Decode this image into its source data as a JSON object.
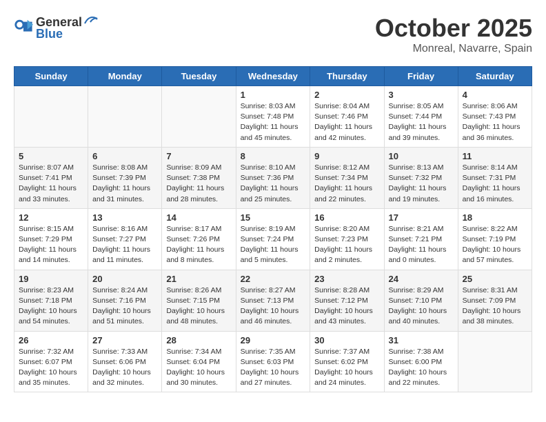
{
  "header": {
    "logo_general": "General",
    "logo_blue": "Blue",
    "month": "October 2025",
    "location": "Monreal, Navarre, Spain"
  },
  "weekdays": [
    "Sunday",
    "Monday",
    "Tuesday",
    "Wednesday",
    "Thursday",
    "Friday",
    "Saturday"
  ],
  "weeks": [
    [
      {
        "day": "",
        "info": ""
      },
      {
        "day": "",
        "info": ""
      },
      {
        "day": "",
        "info": ""
      },
      {
        "day": "1",
        "info": "Sunrise: 8:03 AM\nSunset: 7:48 PM\nDaylight: 11 hours and 45 minutes."
      },
      {
        "day": "2",
        "info": "Sunrise: 8:04 AM\nSunset: 7:46 PM\nDaylight: 11 hours and 42 minutes."
      },
      {
        "day": "3",
        "info": "Sunrise: 8:05 AM\nSunset: 7:44 PM\nDaylight: 11 hours and 39 minutes."
      },
      {
        "day": "4",
        "info": "Sunrise: 8:06 AM\nSunset: 7:43 PM\nDaylight: 11 hours and 36 minutes."
      }
    ],
    [
      {
        "day": "5",
        "info": "Sunrise: 8:07 AM\nSunset: 7:41 PM\nDaylight: 11 hours and 33 minutes."
      },
      {
        "day": "6",
        "info": "Sunrise: 8:08 AM\nSunset: 7:39 PM\nDaylight: 11 hours and 31 minutes."
      },
      {
        "day": "7",
        "info": "Sunrise: 8:09 AM\nSunset: 7:38 PM\nDaylight: 11 hours and 28 minutes."
      },
      {
        "day": "8",
        "info": "Sunrise: 8:10 AM\nSunset: 7:36 PM\nDaylight: 11 hours and 25 minutes."
      },
      {
        "day": "9",
        "info": "Sunrise: 8:12 AM\nSunset: 7:34 PM\nDaylight: 11 hours and 22 minutes."
      },
      {
        "day": "10",
        "info": "Sunrise: 8:13 AM\nSunset: 7:32 PM\nDaylight: 11 hours and 19 minutes."
      },
      {
        "day": "11",
        "info": "Sunrise: 8:14 AM\nSunset: 7:31 PM\nDaylight: 11 hours and 16 minutes."
      }
    ],
    [
      {
        "day": "12",
        "info": "Sunrise: 8:15 AM\nSunset: 7:29 PM\nDaylight: 11 hours and 14 minutes."
      },
      {
        "day": "13",
        "info": "Sunrise: 8:16 AM\nSunset: 7:27 PM\nDaylight: 11 hours and 11 minutes."
      },
      {
        "day": "14",
        "info": "Sunrise: 8:17 AM\nSunset: 7:26 PM\nDaylight: 11 hours and 8 minutes."
      },
      {
        "day": "15",
        "info": "Sunrise: 8:19 AM\nSunset: 7:24 PM\nDaylight: 11 hours and 5 minutes."
      },
      {
        "day": "16",
        "info": "Sunrise: 8:20 AM\nSunset: 7:23 PM\nDaylight: 11 hours and 2 minutes."
      },
      {
        "day": "17",
        "info": "Sunrise: 8:21 AM\nSunset: 7:21 PM\nDaylight: 11 hours and 0 minutes."
      },
      {
        "day": "18",
        "info": "Sunrise: 8:22 AM\nSunset: 7:19 PM\nDaylight: 10 hours and 57 minutes."
      }
    ],
    [
      {
        "day": "19",
        "info": "Sunrise: 8:23 AM\nSunset: 7:18 PM\nDaylight: 10 hours and 54 minutes."
      },
      {
        "day": "20",
        "info": "Sunrise: 8:24 AM\nSunset: 7:16 PM\nDaylight: 10 hours and 51 minutes."
      },
      {
        "day": "21",
        "info": "Sunrise: 8:26 AM\nSunset: 7:15 PM\nDaylight: 10 hours and 48 minutes."
      },
      {
        "day": "22",
        "info": "Sunrise: 8:27 AM\nSunset: 7:13 PM\nDaylight: 10 hours and 46 minutes."
      },
      {
        "day": "23",
        "info": "Sunrise: 8:28 AM\nSunset: 7:12 PM\nDaylight: 10 hours and 43 minutes."
      },
      {
        "day": "24",
        "info": "Sunrise: 8:29 AM\nSunset: 7:10 PM\nDaylight: 10 hours and 40 minutes."
      },
      {
        "day": "25",
        "info": "Sunrise: 8:31 AM\nSunset: 7:09 PM\nDaylight: 10 hours and 38 minutes."
      }
    ],
    [
      {
        "day": "26",
        "info": "Sunrise: 7:32 AM\nSunset: 6:07 PM\nDaylight: 10 hours and 35 minutes."
      },
      {
        "day": "27",
        "info": "Sunrise: 7:33 AM\nSunset: 6:06 PM\nDaylight: 10 hours and 32 minutes."
      },
      {
        "day": "28",
        "info": "Sunrise: 7:34 AM\nSunset: 6:04 PM\nDaylight: 10 hours and 30 minutes."
      },
      {
        "day": "29",
        "info": "Sunrise: 7:35 AM\nSunset: 6:03 PM\nDaylight: 10 hours and 27 minutes."
      },
      {
        "day": "30",
        "info": "Sunrise: 7:37 AM\nSunset: 6:02 PM\nDaylight: 10 hours and 24 minutes."
      },
      {
        "day": "31",
        "info": "Sunrise: 7:38 AM\nSunset: 6:00 PM\nDaylight: 10 hours and 22 minutes."
      },
      {
        "day": "",
        "info": ""
      }
    ]
  ]
}
